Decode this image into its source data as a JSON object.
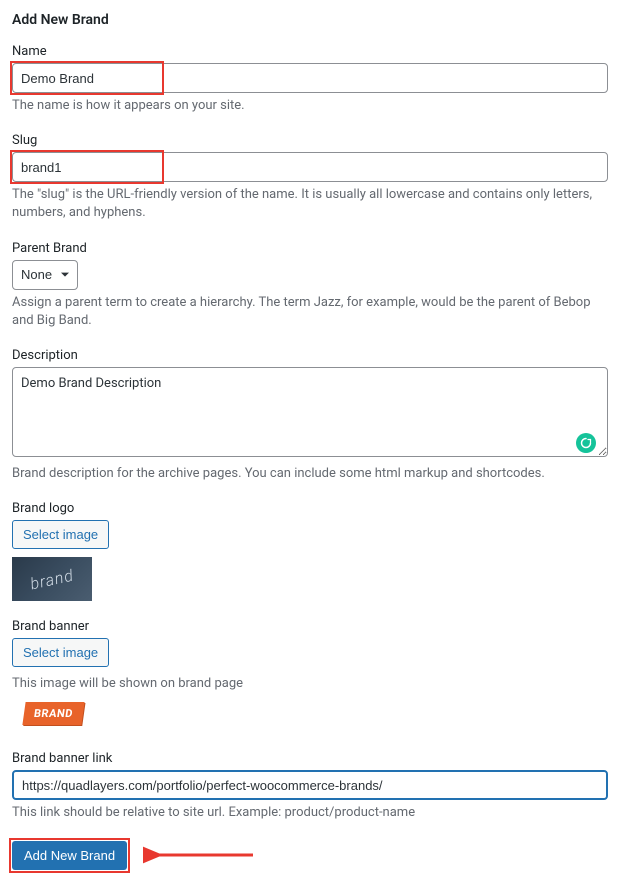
{
  "heading": "Add New Brand",
  "name": {
    "label": "Name",
    "value": "Demo Brand",
    "help": "The name is how it appears on your site."
  },
  "slug": {
    "label": "Slug",
    "value": "brand1",
    "help": "The \"slug\" is the URL-friendly version of the name. It is usually all lowercase and contains only letters, numbers, and hyphens."
  },
  "parent": {
    "label": "Parent Brand",
    "selected": "None",
    "help": "Assign a parent term to create a hierarchy. The term Jazz, for example, would be the parent of Bebop and Big Band."
  },
  "description": {
    "label": "Description",
    "value": "Demo Brand Description",
    "help": "Brand description for the archive pages. You can include some html markup and shortcodes."
  },
  "logo": {
    "label": "Brand logo",
    "button": "Select image",
    "preview_text": "brand"
  },
  "banner": {
    "label": "Brand banner",
    "button": "Select image",
    "help": "This image will be shown on brand page",
    "preview_text": "BRAND"
  },
  "banner_link": {
    "label": "Brand banner link",
    "value": "https://quadlayers.com/portfolio/perfect-woocommerce-brands/",
    "help": "This link should be relative to site url. Example: product/product-name"
  },
  "submit": {
    "label": "Add New Brand"
  }
}
